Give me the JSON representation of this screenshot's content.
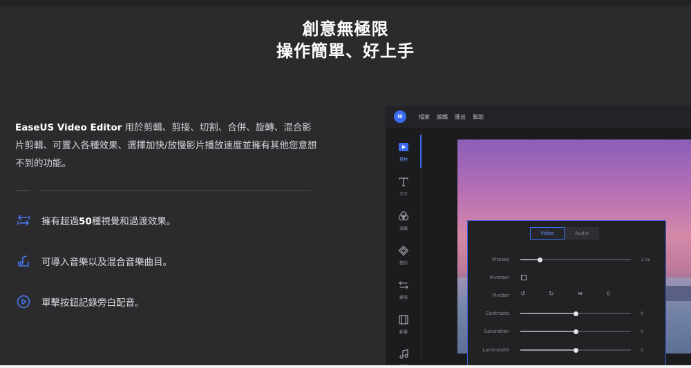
{
  "headline": {
    "line1": "創意無極限",
    "line2": "操作簡單、好上手"
  },
  "intro": {
    "brand": "EaseUS Video Editor",
    "text": " 用於剪輯、剪接、切割、合併、旋轉、混合影片剪輯、可置入各種效果、選擇加快/放慢影片播放速度並擁有其他您意想不到的功能。"
  },
  "features": [
    {
      "icon": "transition-arrows-icon",
      "pre": "擁有超過",
      "bold": "50",
      "post": "種視覺和過渡效果。"
    },
    {
      "icon": "audio-import-icon",
      "text": "可導入音樂以及混合音樂曲目。"
    },
    {
      "icon": "play-circle-icon",
      "text": "單擊按鈕記錄旁白配音。"
    }
  ],
  "editor": {
    "logo": "Ili",
    "menu": [
      "檔案",
      "編輯",
      "匯出",
      "幫助"
    ],
    "sidebar": [
      {
        "label": "素材",
        "icon": "media-icon",
        "active": true
      },
      {
        "label": "文字",
        "icon": "text-icon"
      },
      {
        "label": "濾鏡",
        "icon": "filter-icon"
      },
      {
        "label": "疊加",
        "icon": "overlay-icon"
      },
      {
        "label": "轉場",
        "icon": "transition-icon"
      },
      {
        "label": "動畫",
        "icon": "film-icon"
      },
      {
        "label": "配樂",
        "icon": "music-icon"
      }
    ],
    "panel": {
      "tabs": [
        "Video",
        "Audio"
      ],
      "active_tab": "Video",
      "rows": {
        "vitesse": {
          "label": "Vitesse",
          "value": "1.0x",
          "level": 0.18
        },
        "inverser": {
          "label": "Inverser"
        },
        "pivoter": {
          "label": "Pivoter"
        },
        "contraste": {
          "label": "Contraste",
          "value": "0",
          "level": 0.5
        },
        "saturation": {
          "label": "Saturation",
          "value": "0",
          "level": 0.5
        },
        "luminosite": {
          "label": "Luminosité",
          "value": "0",
          "level": 0.5
        }
      }
    }
  },
  "colors": {
    "background": "#2b2b2e",
    "accent": "#3b6cf0",
    "icon_blue": "#4a7bf7"
  }
}
